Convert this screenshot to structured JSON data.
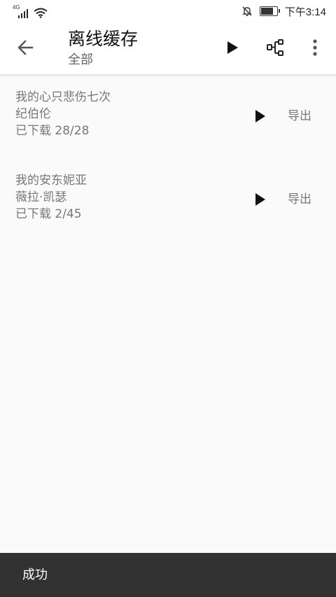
{
  "status_bar": {
    "network": "4G",
    "time": "下午3:14"
  },
  "app_bar": {
    "title": "离线缓存",
    "subtitle": "全部",
    "icons": {
      "back": "arrow-back-icon",
      "play": "play-icon",
      "tree": "tree-structure-icon",
      "more": "more-vert-icon"
    }
  },
  "items": [
    {
      "title": "我的心只悲伤七次",
      "artist": "纪伯伦",
      "progress": "已下载 28/28",
      "export_label": "导出"
    },
    {
      "title": "我的安东妮亚",
      "artist": "薇拉·凯瑟",
      "progress": "已下载 2/45",
      "export_label": "导出"
    }
  ],
  "snackbar": {
    "message": "成功"
  },
  "colors": {
    "snackbar_bg": "#323232",
    "secondary_text": "#777777",
    "primary_text": "#111111"
  }
}
